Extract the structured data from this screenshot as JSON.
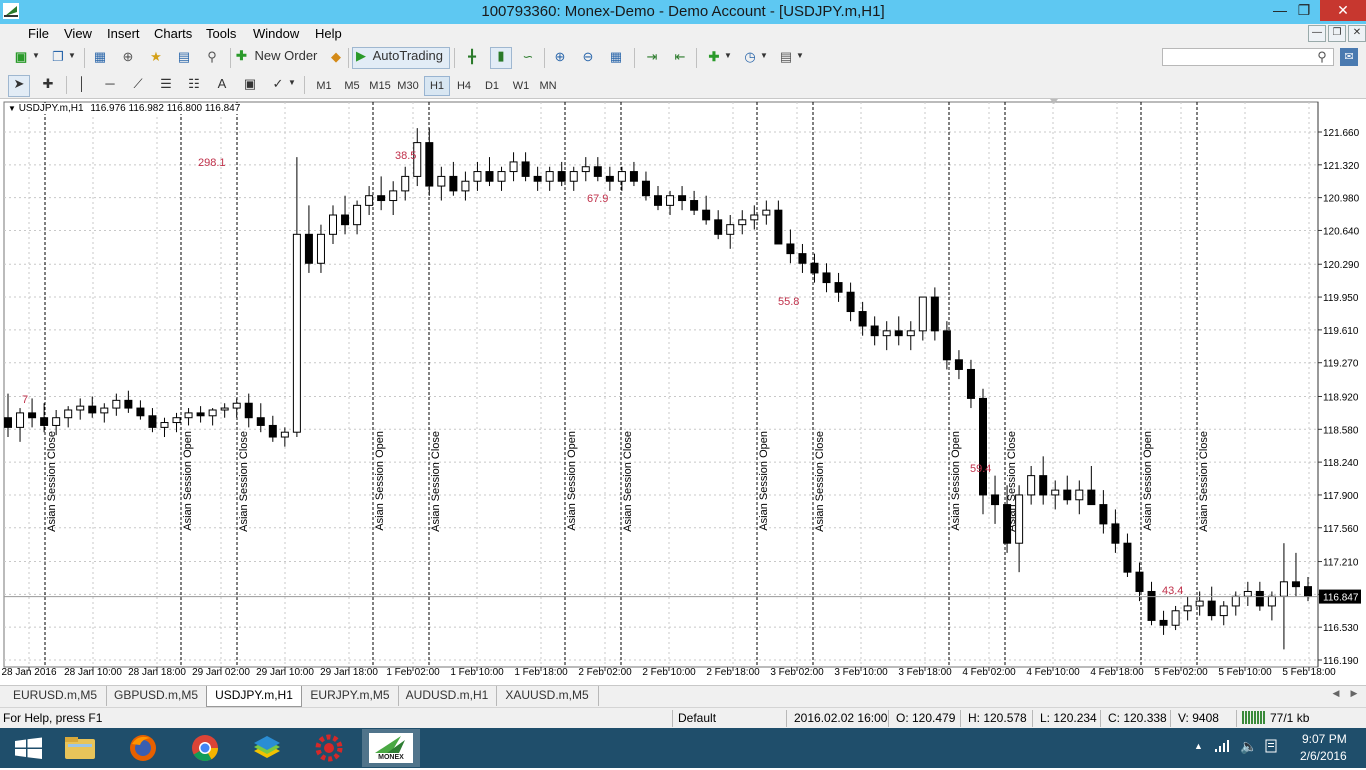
{
  "window": {
    "title": "100793360: Monex-Demo - Demo Account - [USDJPY.m,H1]"
  },
  "menu": {
    "items": [
      "File",
      "View",
      "Insert",
      "Charts",
      "Tools",
      "Window",
      "Help"
    ]
  },
  "toolbar": {
    "new_order": "New Order",
    "autotrading": "AutoTrading",
    "search_placeholder": ""
  },
  "timeframes": [
    "M1",
    "M5",
    "M15",
    "M30",
    "H1",
    "H4",
    "D1",
    "W1",
    "MN"
  ],
  "active_timeframe": "H1",
  "chart_header": {
    "symbol": "USDJPY.m,H1",
    "ohlc": "116.976 116.982 116.800 116.847"
  },
  "chart_data": {
    "type": "candlestick",
    "symbol": "USDJPY.m",
    "timeframe": "H1",
    "y_ticks": [
      "121.660",
      "121.320",
      "120.980",
      "120.640",
      "120.290",
      "119.950",
      "119.610",
      "119.270",
      "118.920",
      "118.580",
      "118.240",
      "117.900",
      "117.560",
      "117.210",
      "116.870",
      "116.530",
      "116.190"
    ],
    "x_ticks": [
      "28 Jan 2016",
      "28 Jan 10:00",
      "28 Jan 18:00",
      "29 Jan 02:00",
      "29 Jan 10:00",
      "29 Jan 18:00",
      "1 Feb 02:00",
      "1 Feb 10:00",
      "1 Feb 18:00",
      "2 Feb 02:00",
      "2 Feb 10:00",
      "2 Feb 18:00",
      "3 Feb 02:00",
      "3 Feb 10:00",
      "3 Feb 18:00",
      "4 Feb 02:00",
      "4 Feb 10:00",
      "4 Feb 18:00",
      "5 Feb 02:00",
      "5 Feb 10:00",
      "5 Feb 18:00"
    ],
    "current_price": "116.847",
    "ylim": [
      116.19,
      121.66
    ],
    "session_labels": [
      "Asian Session Close",
      "Asian Session Open",
      "Asian Session Close",
      "Asian Session Open",
      "Asian Session Close",
      "Asian Session Open",
      "Asian Session Close",
      "Asian Session Open",
      "Asian Session Close",
      "Asian Session Open",
      "Asian Session Close",
      "Asian Session Open",
      "Asian Session Close"
    ],
    "range_labels": [
      "7",
      "298.1",
      "38.5",
      "67.9",
      "55.8",
      "59.4",
      "43.4"
    ],
    "candles": [
      [
        118.7,
        118.95,
        118.5,
        118.6
      ],
      [
        118.6,
        118.8,
        118.45,
        118.75
      ],
      [
        118.75,
        118.9,
        118.6,
        118.7
      ],
      [
        118.7,
        118.85,
        118.55,
        118.62
      ],
      [
        118.62,
        118.78,
        118.52,
        118.7
      ],
      [
        118.7,
        118.82,
        118.6,
        118.78
      ],
      [
        118.78,
        118.9,
        118.68,
        118.82
      ],
      [
        118.82,
        118.92,
        118.7,
        118.75
      ],
      [
        118.75,
        118.85,
        118.65,
        118.8
      ],
      [
        118.8,
        118.95,
        118.72,
        118.88
      ],
      [
        118.88,
        118.98,
        118.75,
        118.8
      ],
      [
        118.8,
        118.88,
        118.68,
        118.72
      ],
      [
        118.72,
        118.8,
        118.55,
        118.6
      ],
      [
        118.6,
        118.7,
        118.5,
        118.65
      ],
      [
        118.65,
        118.75,
        118.55,
        118.7
      ],
      [
        118.7,
        118.8,
        118.62,
        118.75
      ],
      [
        118.75,
        118.82,
        118.65,
        118.72
      ],
      [
        118.72,
        118.8,
        118.62,
        118.78
      ],
      [
        118.78,
        118.85,
        118.7,
        118.8
      ],
      [
        118.8,
        118.9,
        118.7,
        118.85
      ],
      [
        118.85,
        118.95,
        118.6,
        118.7
      ],
      [
        118.7,
        118.85,
        118.55,
        118.62
      ],
      [
        118.62,
        118.72,
        118.45,
        118.5
      ],
      [
        118.5,
        118.6,
        118.4,
        118.55
      ],
      [
        118.55,
        121.4,
        118.5,
        120.6
      ],
      [
        120.6,
        120.9,
        120.2,
        120.3
      ],
      [
        120.3,
        120.7,
        120.2,
        120.6
      ],
      [
        120.6,
        120.9,
        120.5,
        120.8
      ],
      [
        120.8,
        121.0,
        120.6,
        120.7
      ],
      [
        120.7,
        120.95,
        120.6,
        120.9
      ],
      [
        120.9,
        121.1,
        120.8,
        121.0
      ],
      [
        121.0,
        121.2,
        120.85,
        120.95
      ],
      [
        120.95,
        121.15,
        120.8,
        121.05
      ],
      [
        121.05,
        121.3,
        120.95,
        121.2
      ],
      [
        121.2,
        121.7,
        121.1,
        121.55
      ],
      [
        121.55,
        121.7,
        121.0,
        121.1
      ],
      [
        121.1,
        121.3,
        120.95,
        121.2
      ],
      [
        121.2,
        121.35,
        121.0,
        121.05
      ],
      [
        121.05,
        121.25,
        120.95,
        121.15
      ],
      [
        121.15,
        121.35,
        121.05,
        121.25
      ],
      [
        121.25,
        121.4,
        121.1,
        121.15
      ],
      [
        121.15,
        121.3,
        121.05,
        121.25
      ],
      [
        121.25,
        121.45,
        121.15,
        121.35
      ],
      [
        121.35,
        121.45,
        121.15,
        121.2
      ],
      [
        121.2,
        121.3,
        121.05,
        121.15
      ],
      [
        121.15,
        121.3,
        121.05,
        121.25
      ],
      [
        121.25,
        121.35,
        121.1,
        121.15
      ],
      [
        121.15,
        121.3,
        121.05,
        121.25
      ],
      [
        121.25,
        121.4,
        121.15,
        121.3
      ],
      [
        121.3,
        121.4,
        121.15,
        121.2
      ],
      [
        121.2,
        121.3,
        121.05,
        121.15
      ],
      [
        121.15,
        121.3,
        121.05,
        121.25
      ],
      [
        121.25,
        121.35,
        121.1,
        121.15
      ],
      [
        121.15,
        121.25,
        120.95,
        121.0
      ],
      [
        121.0,
        121.1,
        120.85,
        120.9
      ],
      [
        120.9,
        121.05,
        120.8,
        121.0
      ],
      [
        121.0,
        121.1,
        120.85,
        120.95
      ],
      [
        120.95,
        121.05,
        120.8,
        120.85
      ],
      [
        120.85,
        121.0,
        120.7,
        120.75
      ],
      [
        120.75,
        120.85,
        120.55,
        120.6
      ],
      [
        120.6,
        120.8,
        120.45,
        120.7
      ],
      [
        120.7,
        120.85,
        120.6,
        120.75
      ],
      [
        120.75,
        120.9,
        120.65,
        120.8
      ],
      [
        120.8,
        120.95,
        120.7,
        120.85
      ],
      [
        120.85,
        120.95,
        120.6,
        120.5
      ],
      [
        120.5,
        120.65,
        120.3,
        120.4
      ],
      [
        120.4,
        120.5,
        120.2,
        120.3
      ],
      [
        120.3,
        120.4,
        120.1,
        120.2
      ],
      [
        120.2,
        120.3,
        120.0,
        120.1
      ],
      [
        120.1,
        120.2,
        119.9,
        120.0
      ],
      [
        120.0,
        120.1,
        119.7,
        119.8
      ],
      [
        119.8,
        119.9,
        119.55,
        119.65
      ],
      [
        119.65,
        119.75,
        119.45,
        119.55
      ],
      [
        119.55,
        119.7,
        119.4,
        119.6
      ],
      [
        119.6,
        119.75,
        119.45,
        119.55
      ],
      [
        119.55,
        119.7,
        119.4,
        119.6
      ],
      [
        119.6,
        119.8,
        119.5,
        119.95
      ],
      [
        119.95,
        120.05,
        119.5,
        119.6
      ],
      [
        119.6,
        119.7,
        119.2,
        119.3
      ],
      [
        119.3,
        119.4,
        119.1,
        119.2
      ],
      [
        119.2,
        119.3,
        118.8,
        118.9
      ],
      [
        118.9,
        119.0,
        117.7,
        117.9
      ],
      [
        117.9,
        118.1,
        117.6,
        117.8
      ],
      [
        117.8,
        118.0,
        117.3,
        117.4
      ],
      [
        117.4,
        118.0,
        117.1,
        117.9
      ],
      [
        117.9,
        118.2,
        117.8,
        118.1
      ],
      [
        118.1,
        118.3,
        117.8,
        117.9
      ],
      [
        117.9,
        118.05,
        117.75,
        117.95
      ],
      [
        117.95,
        118.1,
        117.8,
        117.85
      ],
      [
        117.85,
        118.05,
        117.7,
        117.95
      ],
      [
        117.95,
        118.2,
        117.8,
        117.8
      ],
      [
        117.8,
        117.95,
        117.5,
        117.6
      ],
      [
        117.6,
        117.75,
        117.3,
        117.4
      ],
      [
        117.4,
        117.5,
        117.05,
        117.1
      ],
      [
        117.1,
        117.2,
        116.8,
        116.9
      ],
      [
        116.9,
        117.0,
        116.55,
        116.6
      ],
      [
        116.6,
        116.7,
        116.45,
        116.55
      ],
      [
        116.55,
        116.75,
        116.5,
        116.7
      ],
      [
        116.7,
        116.85,
        116.6,
        116.75
      ],
      [
        116.75,
        116.9,
        116.65,
        116.8
      ],
      [
        116.8,
        116.95,
        116.6,
        116.65
      ],
      [
        116.65,
        116.8,
        116.55,
        116.75
      ],
      [
        116.75,
        116.9,
        116.65,
        116.85
      ],
      [
        116.85,
        117.0,
        116.75,
        116.9
      ],
      [
        116.9,
        117.0,
        116.7,
        116.75
      ],
      [
        116.75,
        116.9,
        116.6,
        116.85
      ],
      [
        116.85,
        117.4,
        116.3,
        117.0
      ],
      [
        117.0,
        117.3,
        116.85,
        116.95
      ],
      [
        116.95,
        117.05,
        116.8,
        116.85
      ]
    ]
  },
  "tabs": [
    "EURUSD.m,M5",
    "GBPUSD.m,M5",
    "USDJPY.m,H1",
    "EURJPY.m,M5",
    "AUDUSD.m,H1",
    "XAUUSD.m,M5"
  ],
  "active_tab": "USDJPY.m,H1",
  "status": {
    "help": "For Help, press F1",
    "profile": "Default",
    "datetime": "2016.02.02 16:00",
    "open": "O: 120.479",
    "high": "H: 120.578",
    "low": "L: 120.234",
    "close": "C: 120.338",
    "volume": "V: 9408",
    "traffic": "77/1 kb"
  },
  "taskbar": {
    "time": "9:07 PM",
    "date": "2/6/2016",
    "monex_label": "MONEX"
  },
  "colors": {
    "titlebar": "#5ec8f2",
    "taskbar": "#1f4e6b",
    "chart_bg": "#ffffff",
    "bull": "#ffffff",
    "bear": "#000000",
    "label_red": "#c0304a"
  }
}
